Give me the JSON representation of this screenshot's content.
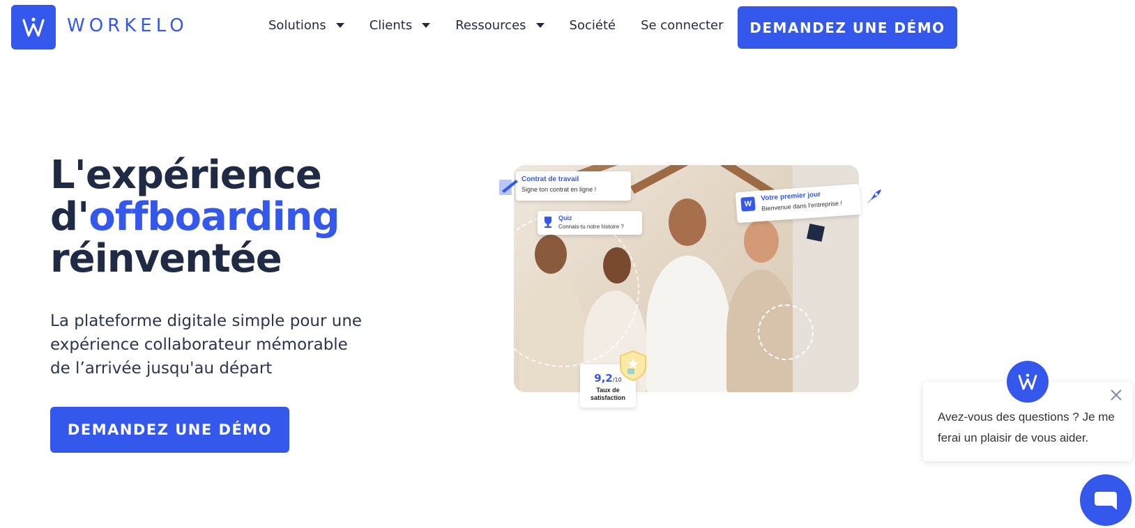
{
  "header": {
    "logo_text": "WORKELO",
    "nav": [
      {
        "label": "Solutions",
        "has_dropdown": true
      },
      {
        "label": "Clients",
        "has_dropdown": true
      },
      {
        "label": "Ressources",
        "has_dropdown": true
      },
      {
        "label": "Société",
        "has_dropdown": false
      },
      {
        "label": "Se connecter",
        "has_dropdown": false
      }
    ],
    "cta_label": "DEMANDEZ UNE DÉMO"
  },
  "hero": {
    "title_line1": "L'expérience",
    "title_prefix": "d'",
    "title_accent": "offboarding",
    "title_line3": "réinventée",
    "subtitle": "La plateforme digitale simple pour une expérience collaborateur mémorable de l’arrivée jusqu'au départ",
    "cta_label": "DEMANDEZ UNE DÉMO"
  },
  "illustration": {
    "card_contract": {
      "title": "Contrat de travail",
      "text": "Signe ton contrat en ligne !"
    },
    "card_quiz": {
      "title": "Quiz",
      "text": "Connais-tu notre histoire ?"
    },
    "card_first_day": {
      "title": "Votre premier jour",
      "text": "Bienvenue dans l'entreprise !"
    },
    "satisfaction": {
      "score": "9,2",
      "scale": "/10",
      "label_line1": "Taux de",
      "label_line2": "satisfaction"
    }
  },
  "chat": {
    "message": "Avez-vous des questions ? Je me ferai un plaisir de vous aider."
  },
  "colors": {
    "brand": "#3458eb",
    "heading": "#1f2a44"
  }
}
